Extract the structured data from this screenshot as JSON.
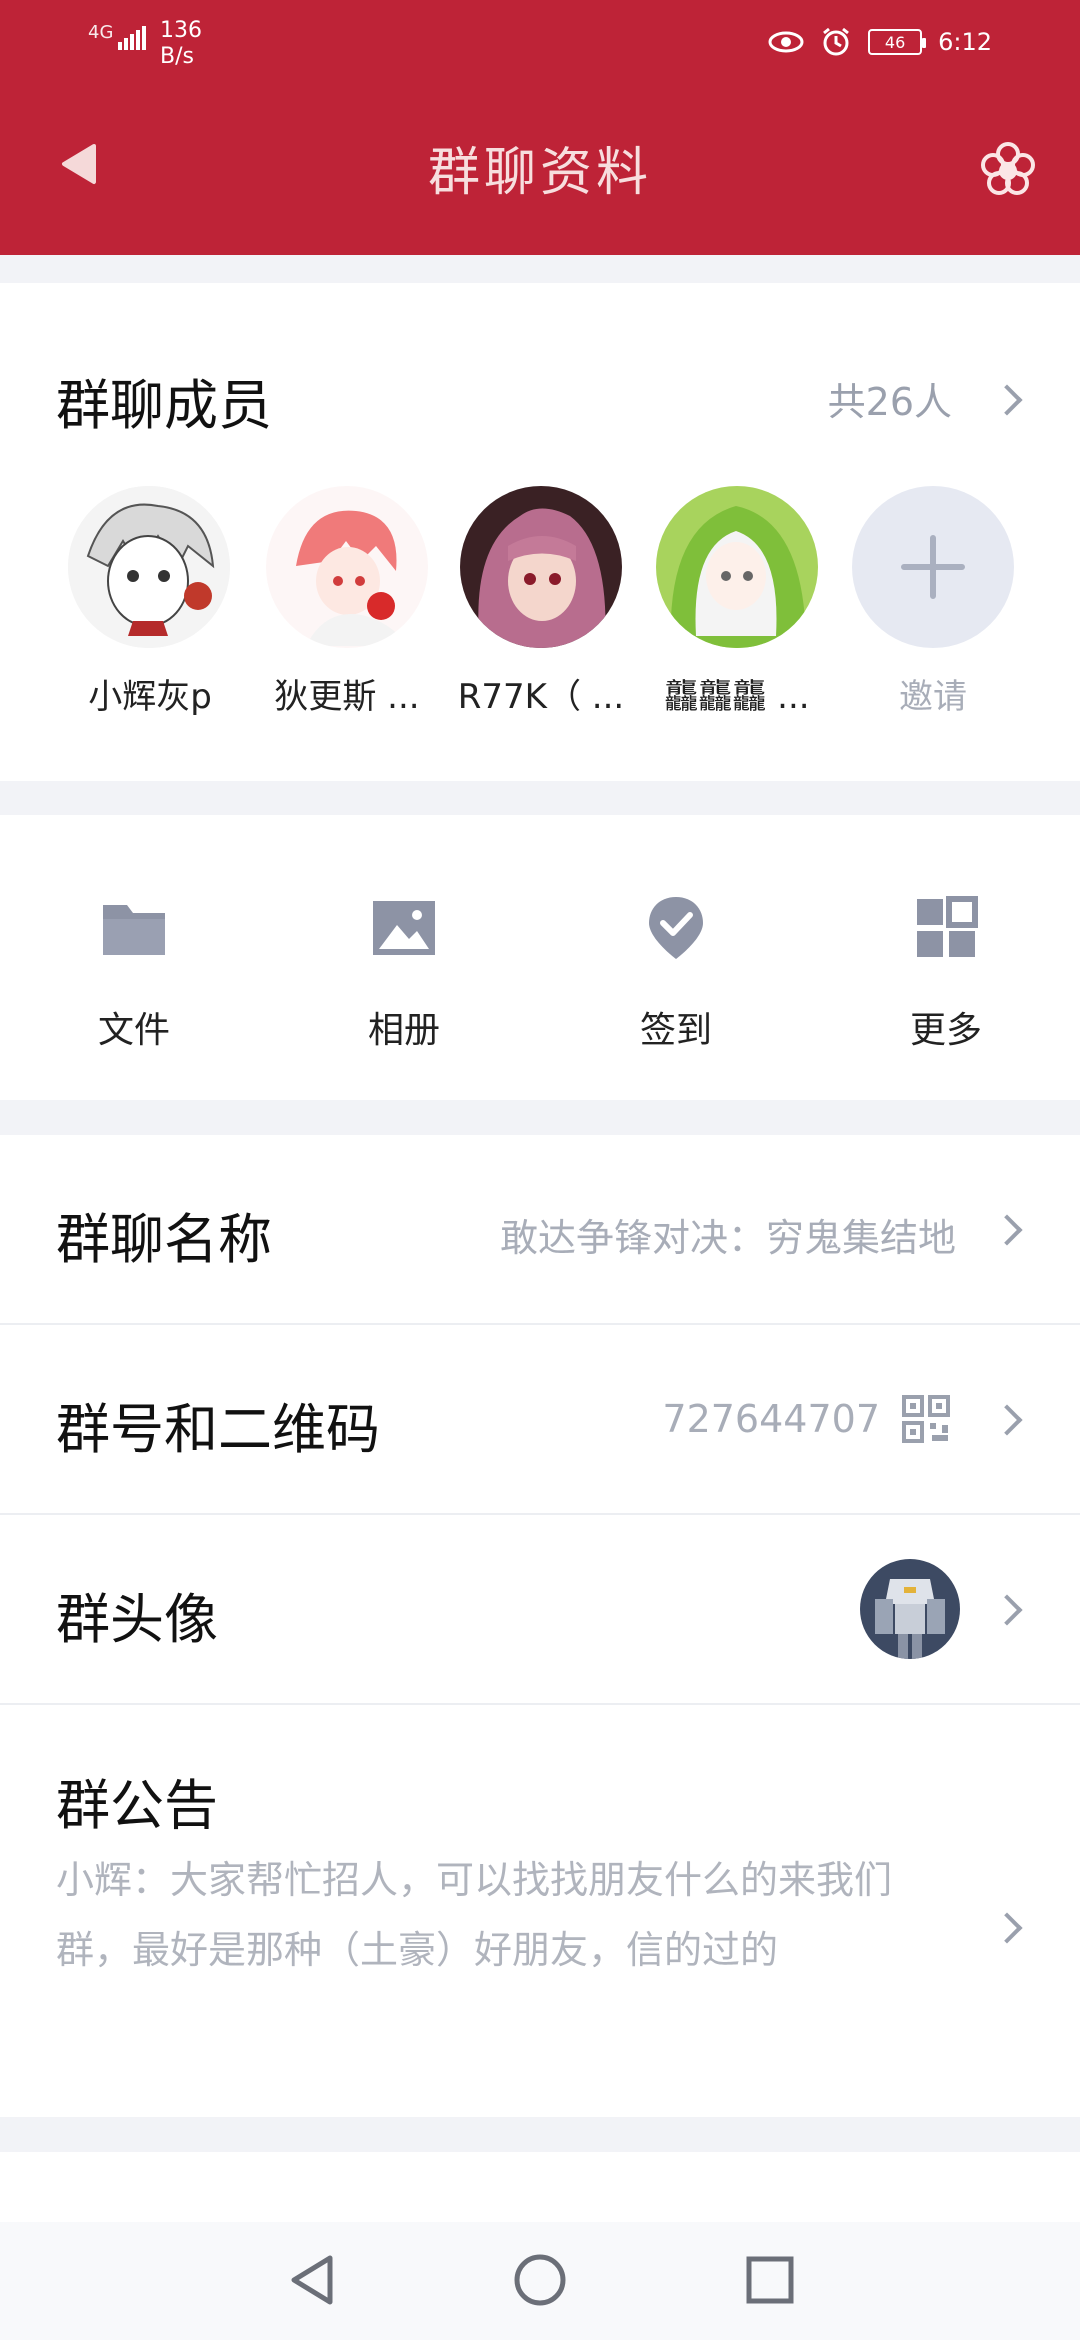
{
  "status_bar": {
    "network": "4G",
    "speed_value": "136",
    "speed_unit": "B/s",
    "battery": "46",
    "time": "6:12"
  },
  "header": {
    "title": "群聊资料"
  },
  "members": {
    "label": "群聊成员",
    "count": "共26人",
    "items": [
      {
        "name": "小辉灰p"
      },
      {
        "name": "狄更斯 ..."
      },
      {
        "name": "R77K（ ..."
      },
      {
        "name": "龘龘龘 ..."
      },
      {
        "name": "邀请"
      }
    ]
  },
  "tools": [
    {
      "label": "文件",
      "icon": "folder-icon"
    },
    {
      "label": "相册",
      "icon": "image-icon"
    },
    {
      "label": "签到",
      "icon": "check-pin-icon"
    },
    {
      "label": "更多",
      "icon": "grid-icon"
    }
  ],
  "group_name": {
    "label": "群聊名称",
    "value": "敢达争锋对决：穷鬼集结地"
  },
  "group_id": {
    "label": "群号和二维码",
    "value": "727644707"
  },
  "group_avatar": {
    "label": "群头像"
  },
  "notice": {
    "label": "群公告",
    "text": "小辉：大家帮忙招人，可以找找朋友什么的来我们群，最好是那种（土豪）好朋友，信的过的"
  },
  "colors": {
    "header_bg": "#be2337",
    "accent_gray": "#9aa0ad",
    "icon_gray": "#8d93a5"
  }
}
